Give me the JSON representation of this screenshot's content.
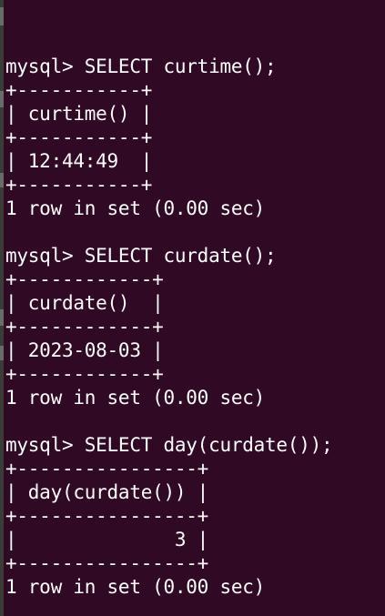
{
  "window": {
    "background": "#300a24",
    "text_color": "#ffffff",
    "left_strip_color": "#3c3b37"
  },
  "terminal": {
    "lines": [
      "mysql> SELECT curtime();",
      "+-----------+",
      "| curtime() |",
      "+-----------+",
      "| 12:44:49  |",
      "+-----------+",
      "1 row in set (0.00 sec)",
      "",
      "mysql> SELECT curdate();",
      "+------------+",
      "| curdate()  |",
      "+------------+",
      "| 2023-08-03 |",
      "+------------+",
      "1 row in set (0.00 sec)",
      "",
      "mysql> SELECT day(curdate());",
      "+----------------+",
      "| day(curdate()) |",
      "+----------------+",
      "|              3 |",
      "+----------------+",
      "1 row in set (0.00 sec)"
    ]
  }
}
